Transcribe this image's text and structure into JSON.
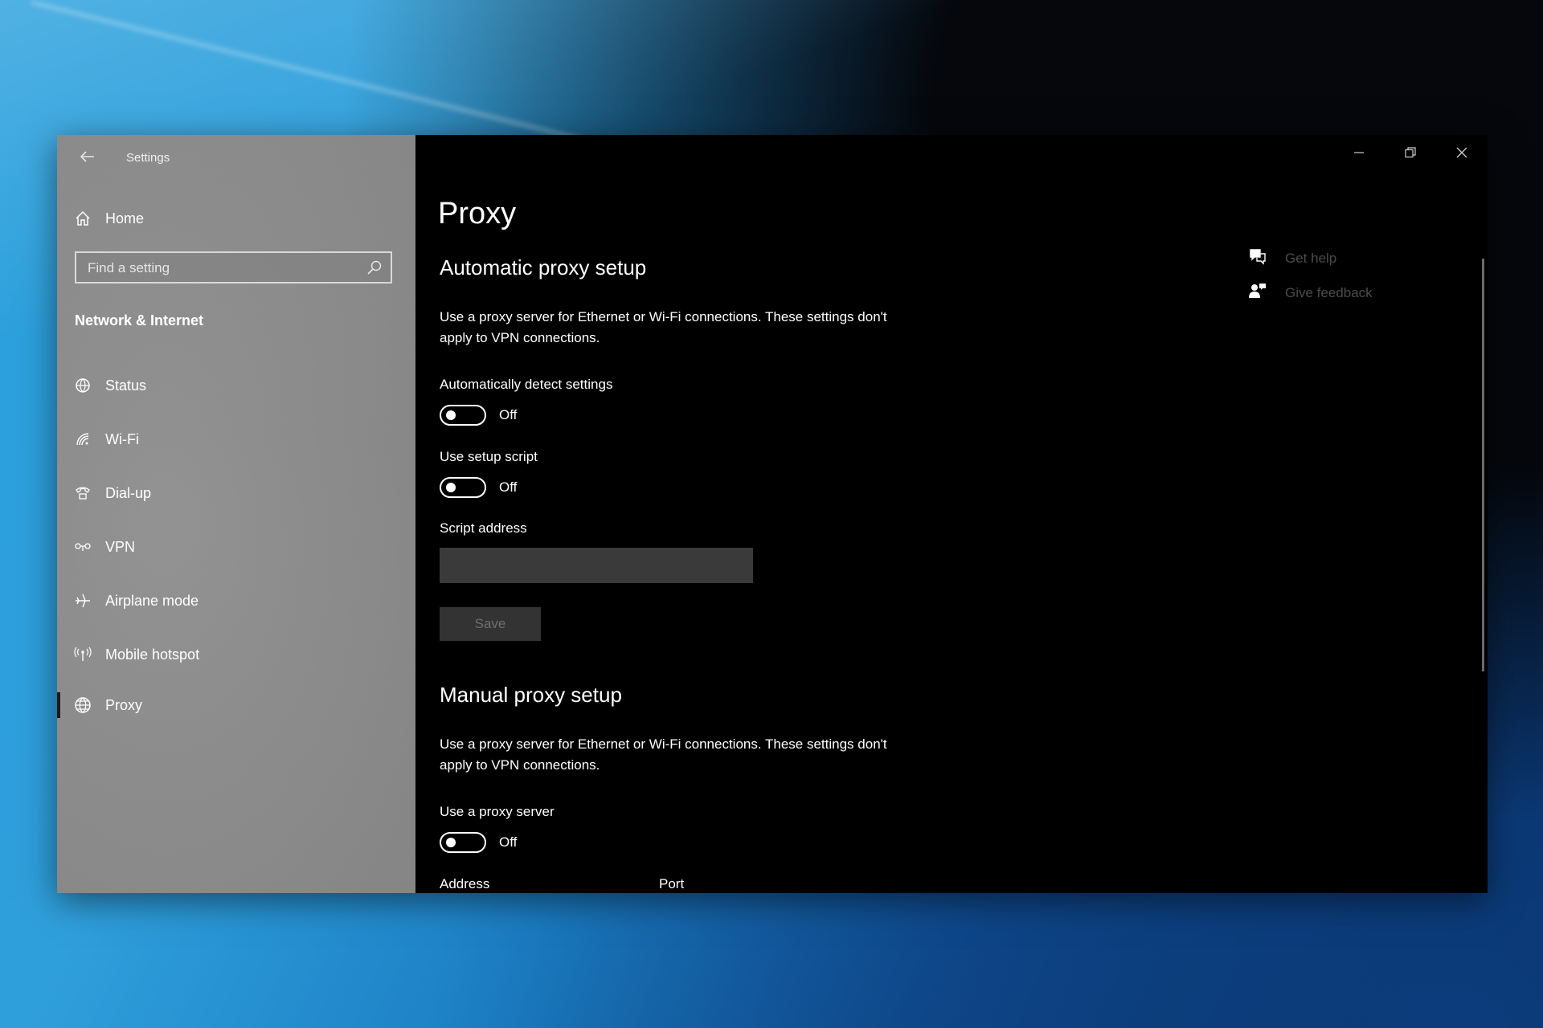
{
  "window": {
    "title": "Settings",
    "back_icon": "back-arrow-icon",
    "controls": [
      "minimize-icon",
      "restore-icon",
      "close-icon"
    ]
  },
  "sidebar": {
    "home_label": "Home",
    "search": {
      "placeholder": "Find a setting",
      "value": ""
    },
    "section_title": "Network & Internet",
    "items": [
      {
        "label": "Status",
        "icon": "status-globe-icon"
      },
      {
        "label": "Wi-Fi",
        "icon": "wifi-icon"
      },
      {
        "label": "Dial-up",
        "icon": "dialup-phone-icon"
      },
      {
        "label": "VPN",
        "icon": "vpn-icon"
      },
      {
        "label": "Airplane mode",
        "icon": "airplane-icon"
      },
      {
        "label": "Mobile hotspot",
        "icon": "hotspot-icon"
      },
      {
        "label": "Proxy",
        "icon": "globe-icon",
        "selected": true
      }
    ]
  },
  "main": {
    "page_title": "Proxy",
    "automatic": {
      "heading": "Automatic proxy setup",
      "description": "Use a proxy server for Ethernet or Wi-Fi connections. These settings don't apply to VPN connections.",
      "auto_detect": {
        "label": "Automatically detect settings",
        "state": "Off"
      },
      "setup_script": {
        "label": "Use setup script",
        "state": "Off"
      },
      "script_address": {
        "label": "Script address",
        "value": ""
      },
      "save_label": "Save"
    },
    "manual": {
      "heading": "Manual proxy setup",
      "description": "Use a proxy server for Ethernet or Wi-Fi connections. These settings don't apply to VPN connections.",
      "use_proxy": {
        "label": "Use a proxy server",
        "state": "Off"
      },
      "address_label": "Address",
      "port_label": "Port"
    },
    "help": {
      "get_help": "Get help",
      "give_feedback": "Give feedback"
    }
  },
  "colors": {
    "sidebar_bg": "#8c8c8c",
    "content_bg": "#000000",
    "text": "#ffffff",
    "disabled_text": "#4c4c4c"
  }
}
